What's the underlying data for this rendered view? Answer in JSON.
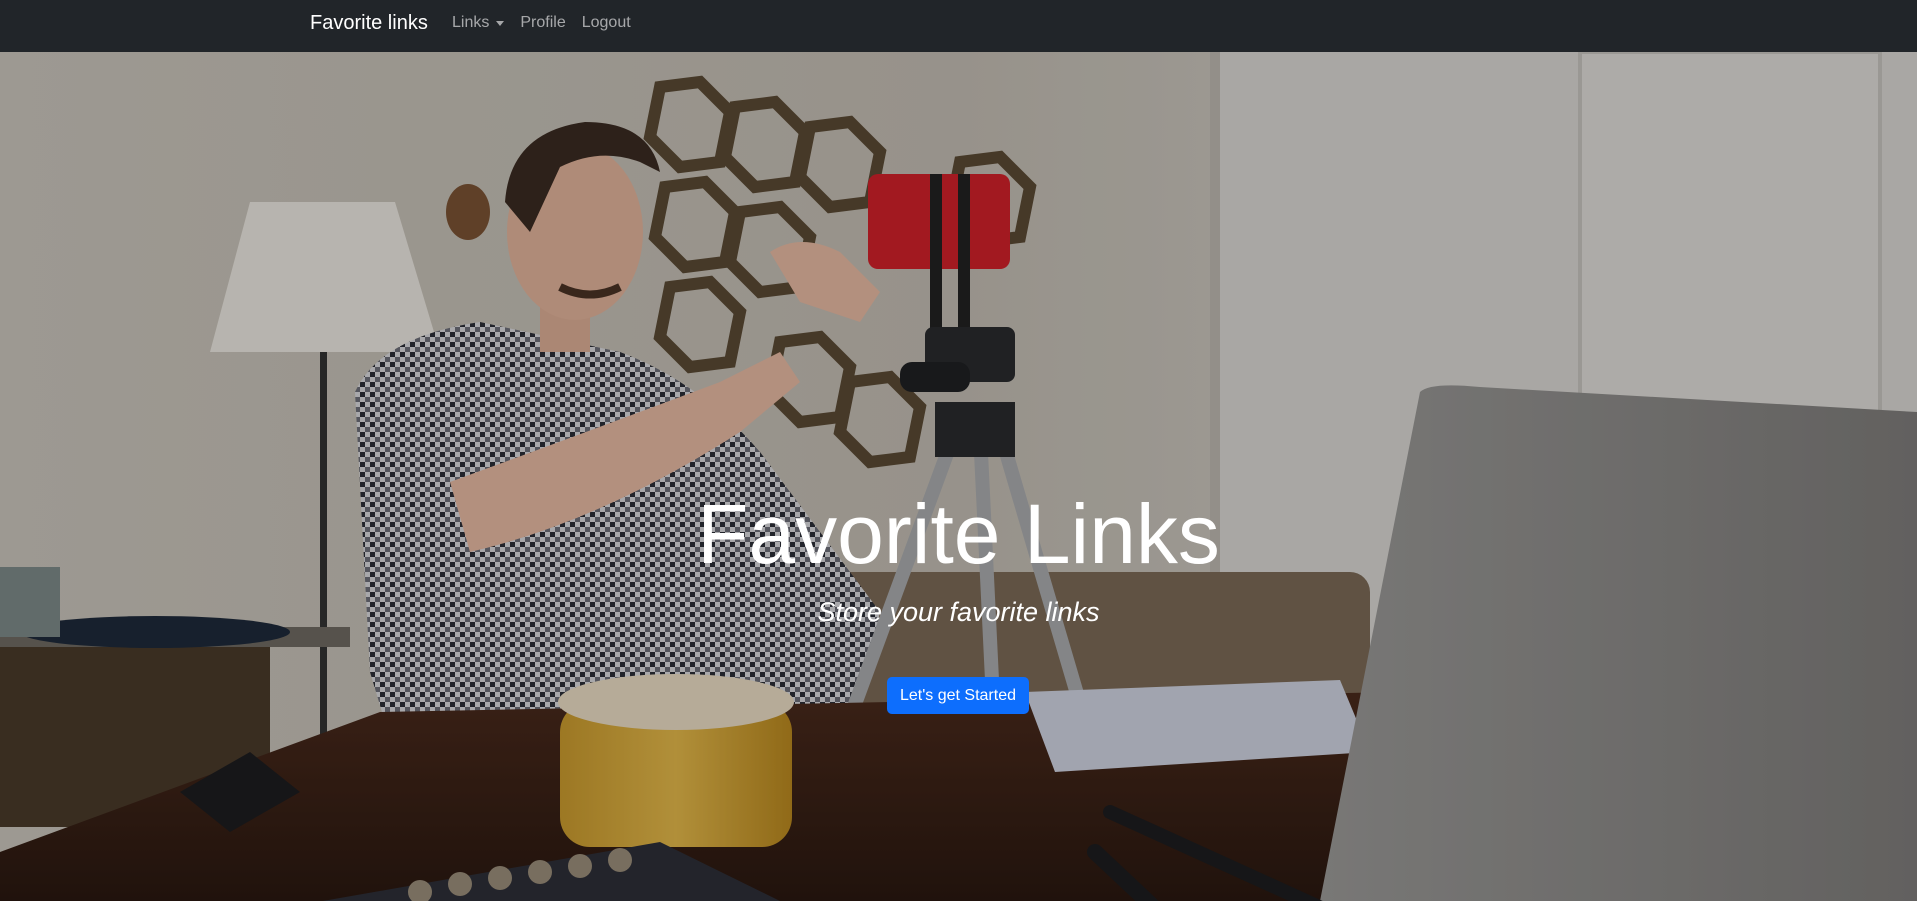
{
  "navbar": {
    "brand": "Favorite links",
    "items": [
      {
        "label": "Links",
        "has_dropdown": true
      },
      {
        "label": "Profile",
        "has_dropdown": false
      },
      {
        "label": "Logout",
        "has_dropdown": false
      }
    ],
    "background_color": "#212529"
  },
  "hero": {
    "title": "Favorite Links",
    "subtitle": "Store your favorite links",
    "cta_label": "Let's get Started",
    "cta_color": "#0d6efd",
    "background_image": "photo of a young man setting up a smartphone on a tripod at a desk"
  }
}
